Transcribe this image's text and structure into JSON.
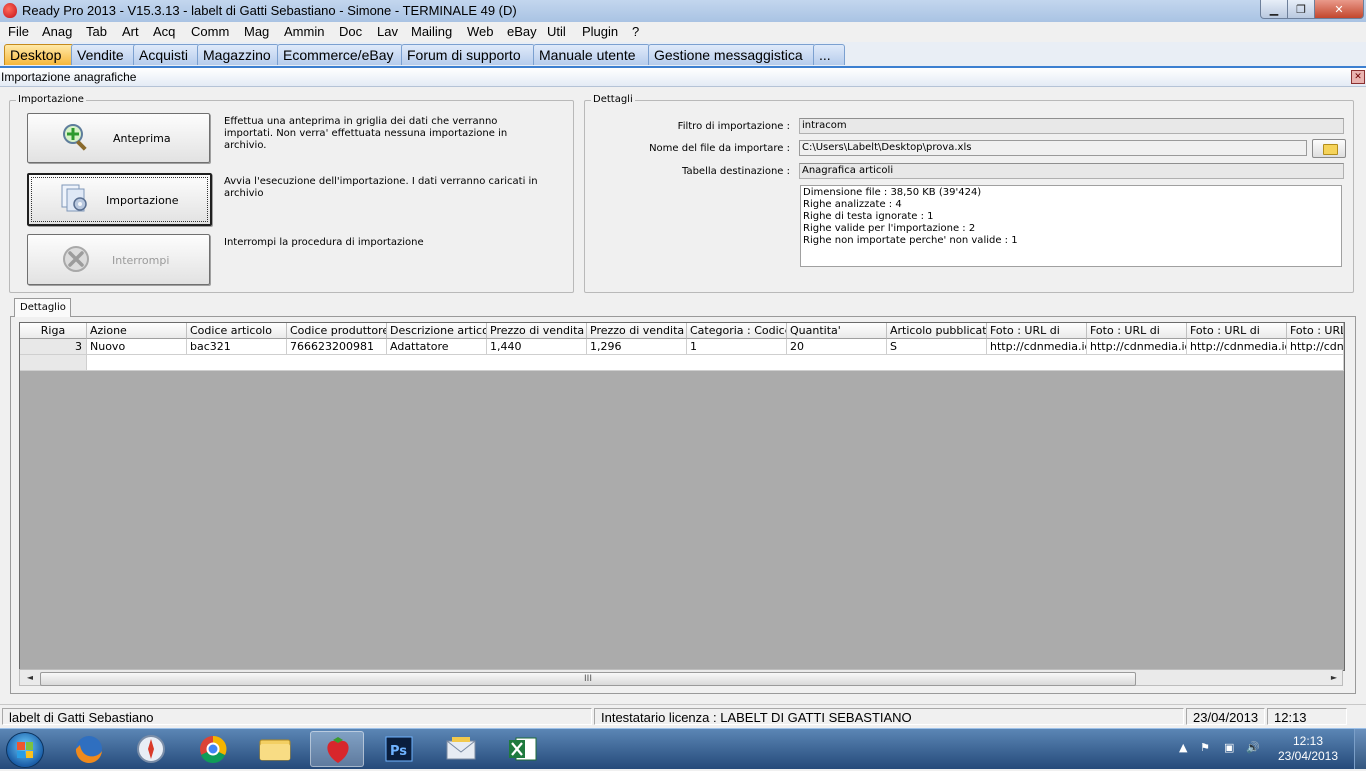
{
  "window": {
    "title": "Ready Pro 2013 - V15.3.13 - labelt di Gatti Sebastiano - Simone - TERMINALE 49 (D)",
    "min_glyph": "▁",
    "max_glyph": "❐",
    "close_glyph": "✕"
  },
  "menu": [
    "File",
    "Anag",
    "Tab",
    "Art",
    "Acq",
    "Comm",
    "Mag",
    "Ammin",
    "Doc",
    "Lav",
    "Mailing",
    "Web",
    "eBay",
    "Util",
    "Plugin",
    "?"
  ],
  "tabs": [
    {
      "label": "Desktop",
      "active": true
    },
    {
      "label": "Vendite"
    },
    {
      "label": "Acquisti"
    },
    {
      "label": "Magazzino"
    },
    {
      "label": "Ecommerce/eBay"
    },
    {
      "label": "Forum di supporto"
    },
    {
      "label": "Manuale utente"
    },
    {
      "label": "Gestione messaggistica"
    },
    {
      "label": "..."
    }
  ],
  "child": {
    "title": "Importazione anagrafiche",
    "close_glyph": "✕"
  },
  "import_group": {
    "title": "Importazione",
    "preview_button": "Anteprima",
    "preview_desc": "Effettua una anteprima in griglia dei dati che verranno importati. Non verra' effettuata nessuna importazione in archivio.",
    "import_button": "Importazione",
    "import_desc": "Avvia l'esecuzione dell'importazione. I dati verranno caricati in archivio",
    "stop_button": "Interrompi",
    "stop_desc": "Interrompi la procedura di importazione"
  },
  "details_group": {
    "title": "Dettagli",
    "filter_label": "Filtro di importazione :",
    "filter_value": "intracom",
    "file_label": "Nome del file da importare :",
    "file_value": "C:\\Users\\Labelt\\Desktop\\prova.xls",
    "table_label": "Tabella destinazione :",
    "table_value": "Anagrafica articoli",
    "summary": [
      "Dimensione file : 38,50 KB (39'424)",
      "Righe analizzate : 4",
      "Righe di testa ignorate : 1",
      "Righe valide per l'importazione : 2",
      "Righe non importate perche' non valide : 1"
    ]
  },
  "detail_tab": "Dettaglio",
  "grid": {
    "columns": [
      "Riga",
      "Azione",
      "Codice articolo",
      "Codice produttore",
      "Descrizione articolo",
      "Prezzo di vendita",
      "Prezzo di vendita",
      "Categoria : Codice",
      "Quantita'",
      "Articolo pubblicato",
      "Foto : URL di",
      "Foto : URL di",
      "Foto : URL di",
      "Foto : URL"
    ],
    "rows": [
      [
        "3",
        "Nuovo",
        "bac321",
        "766623200981",
        "Adattatore",
        "1,440",
        "1,296",
        "1",
        "20",
        "S",
        "http://cdnmedia.ici",
        "http://cdnmedia.ici",
        "http://cdnmedia.ici",
        "http://cdnm"
      ]
    ]
  },
  "scrollbar": {
    "left": "◄",
    "right": "►",
    "grip": "III"
  },
  "status": {
    "user": "labelt di Gatti Sebastiano",
    "license": "Intestatario licenza : LABELT DI GATTI SEBASTIANO",
    "date": "23/04/2013",
    "time": "12:13"
  },
  "taskbar": {
    "clock_time": "12:13",
    "clock_date": "23/04/2013",
    "tray": [
      "▲",
      "⚑",
      "▣",
      "🔊"
    ]
  },
  "colors": {
    "accent_tab": "#f6b73c",
    "taskbar": "#254a7a"
  }
}
